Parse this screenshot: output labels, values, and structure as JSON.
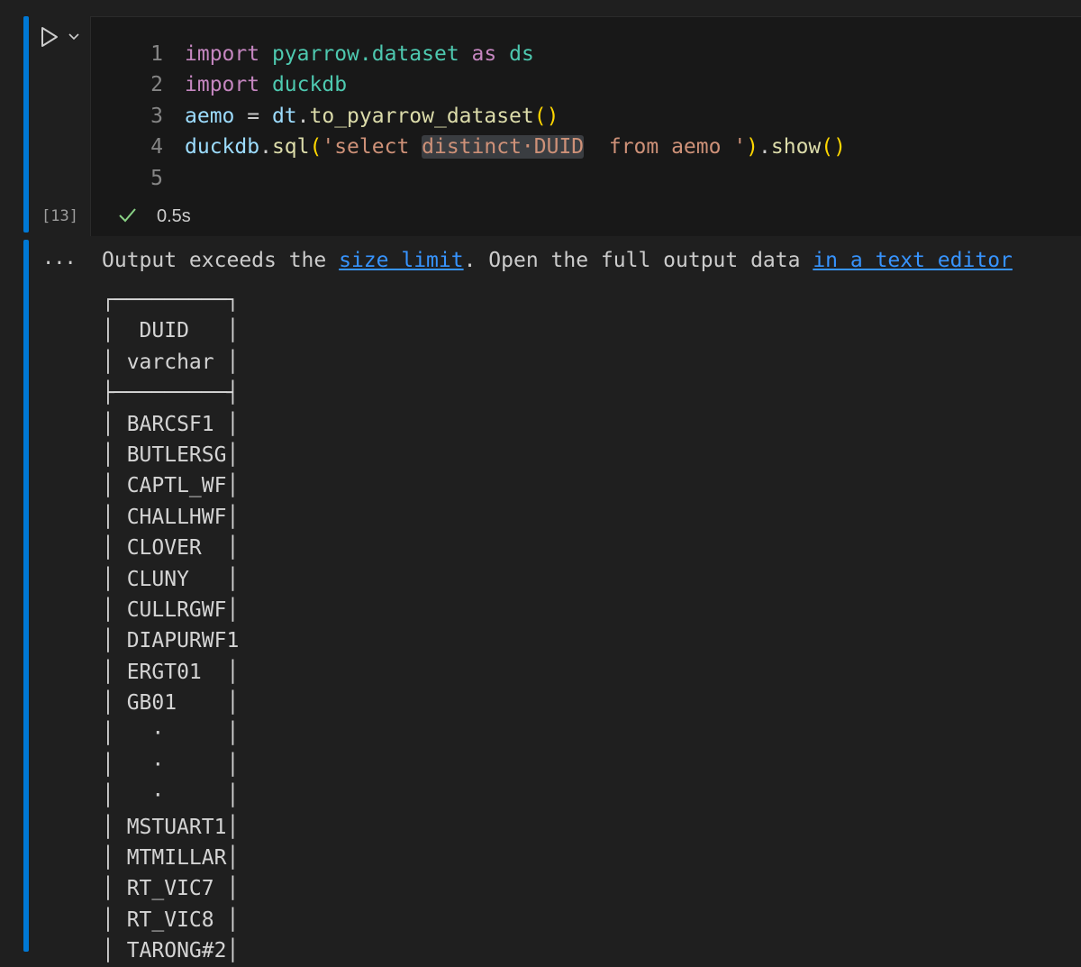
{
  "cell": {
    "execution_count": "[13]",
    "status": {
      "duration": "0.5s",
      "state": "success"
    },
    "code_lines": [
      {
        "number": "1",
        "segments": [
          {
            "t": "import",
            "c": "kw"
          },
          {
            "t": " ",
            "c": "plain"
          },
          {
            "t": "pyarrow.dataset",
            "c": "mod"
          },
          {
            "t": " ",
            "c": "plain"
          },
          {
            "t": "as",
            "c": "kw"
          },
          {
            "t": " ",
            "c": "plain"
          },
          {
            "t": "ds",
            "c": "mod"
          }
        ]
      },
      {
        "number": "2",
        "segments": [
          {
            "t": "import",
            "c": "kw"
          },
          {
            "t": " ",
            "c": "plain"
          },
          {
            "t": "duckdb",
            "c": "mod"
          }
        ]
      },
      {
        "number": "3",
        "segments": [
          {
            "t": "aemo",
            "c": "var"
          },
          {
            "t": " = ",
            "c": "plain"
          },
          {
            "t": "dt",
            "c": "var"
          },
          {
            "t": ".",
            "c": "plain"
          },
          {
            "t": "to_pyarrow_dataset",
            "c": "fn"
          },
          {
            "t": "()",
            "c": "par"
          }
        ]
      },
      {
        "number": "4",
        "segments": [
          {
            "t": "duckdb",
            "c": "var"
          },
          {
            "t": ".",
            "c": "plain"
          },
          {
            "t": "sql",
            "c": "fn"
          },
          {
            "t": "(",
            "c": "par"
          },
          {
            "t": "'select ",
            "c": "str"
          },
          {
            "t": "distinct·DUID",
            "c": "str hl"
          },
          {
            "t": "  from aemo '",
            "c": "str"
          },
          {
            "t": ")",
            "c": "par"
          },
          {
            "t": ".",
            "c": "plain"
          },
          {
            "t": "show",
            "c": "fn"
          },
          {
            "t": "()",
            "c": "par"
          }
        ]
      },
      {
        "number": "5",
        "segments": []
      }
    ]
  },
  "output": {
    "warning_prefix": "Output exceeds the ",
    "size_limit_link": "size limit",
    "warning_middle": ". Open the full output data ",
    "text_editor_link": "in a text editor",
    "table_lines": [
      "┌─────────┐",
      "│  DUID   │",
      "│ varchar │",
      "├─────────┤",
      "│ BARCSF1 │",
      "│ BUTLERSG│",
      "│ CAPTL_WF│",
      "│ CHALLHWF│",
      "│ CLOVER  │",
      "│ CLUNY   │",
      "│ CULLRGWF│",
      "│ DIAPURWF1",
      "│ ERGT01  │",
      "│ GB01    │",
      "│   ·     │",
      "│   ·     │",
      "│   ·     │",
      "│ MSTUART1│",
      "│ MTMILLAR│",
      "│ RT_VIC7 │",
      "│ RT_VIC8 │",
      "│ TARONG#2│"
    ]
  },
  "colors": {
    "accent": "#0078d4",
    "success": "#89d185",
    "link": "#3794ff"
  }
}
